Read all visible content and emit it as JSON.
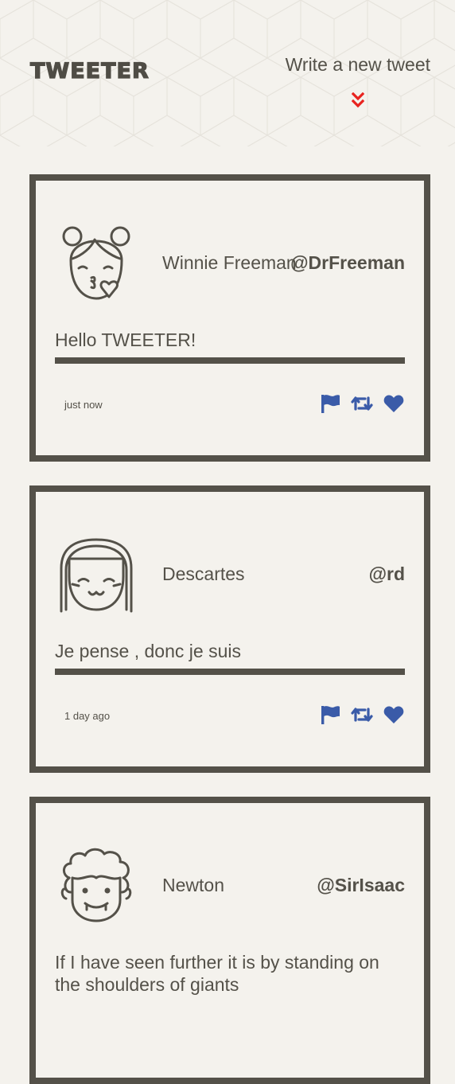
{
  "nav": {
    "brand": "TWEETER",
    "compose_label": "Write a new tweet",
    "compose_icon": "double-chevron-down-icon",
    "compose_icon_color": "#e8231f"
  },
  "colors": {
    "background": "#f4f2ed",
    "text": "#545149",
    "border": "#545149",
    "action": "#3a5ba8"
  },
  "tweets": [
    {
      "avatar": "girl-kiss-avatar-icon",
      "name": "Winnie Freeman",
      "handle": "@DrFreeman",
      "text": "Hello TWEETER!",
      "time": "just now"
    },
    {
      "avatar": "girl-smile-avatar-icon",
      "name": "Descartes",
      "handle": "@rd",
      "text": "Je pense , donc je suis",
      "time": "1 day ago"
    },
    {
      "avatar": "curly-hair-avatar-icon",
      "name": "Newton",
      "handle": "@SirIsaac",
      "text": "If I have seen further it is by standing on the shoulders of giants",
      "time": ""
    }
  ],
  "actions": {
    "flag_icon": "flag-icon",
    "retweet_icon": "retweet-icon",
    "like_icon": "heart-icon"
  }
}
